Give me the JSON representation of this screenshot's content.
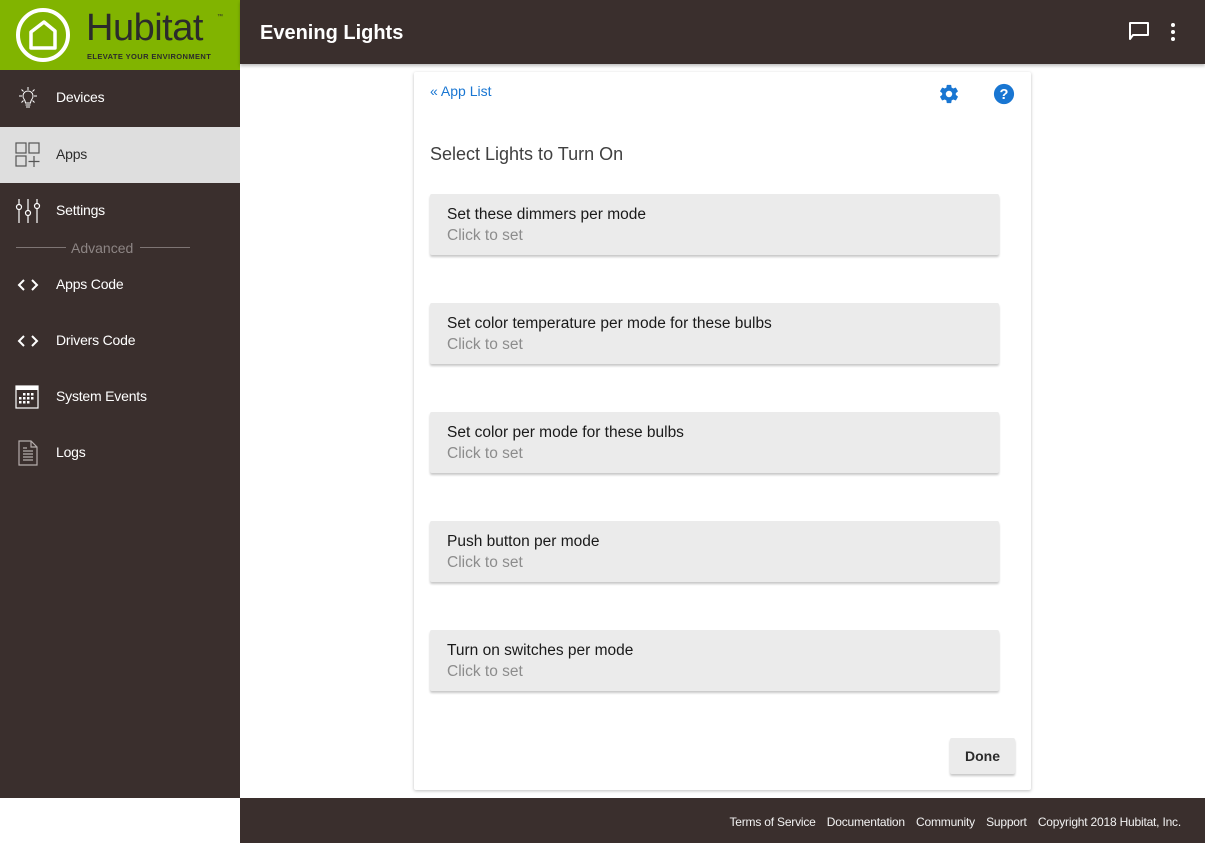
{
  "brand": {
    "name": "Hubitat",
    "trademark": "™",
    "tagline": "ELEVATE YOUR ENVIRONMENT",
    "color": "#81b400"
  },
  "header": {
    "title": "Evening Lights",
    "icons": [
      "chat-icon",
      "more-vert-icon"
    ]
  },
  "sidebar": {
    "items": [
      {
        "label": "Devices",
        "icon": "lightbulb-icon",
        "active": false
      },
      {
        "label": "Apps",
        "icon": "apps-grid-icon",
        "active": true
      },
      {
        "label": "Settings",
        "icon": "sliders-icon",
        "active": false
      },
      {
        "label": "Apps Code",
        "icon": "code-icon",
        "active": false
      },
      {
        "label": "Drivers Code",
        "icon": "code-icon",
        "active": false
      },
      {
        "label": "System Events",
        "icon": "calendar-icon",
        "active": false
      },
      {
        "label": "Logs",
        "icon": "document-icon",
        "active": false
      }
    ],
    "section_divider": "Advanced"
  },
  "main": {
    "back_link": "« App List",
    "section_title": "Select Lights to Turn On",
    "settings": [
      {
        "title": "Set these dimmers per mode",
        "subtitle": "Click to set"
      },
      {
        "title": "Set color temperature per mode for these bulbs",
        "subtitle": "Click to set"
      },
      {
        "title": "Set color per mode for these bulbs",
        "subtitle": "Click to set"
      },
      {
        "title": "Push button per mode",
        "subtitle": "Click to set"
      },
      {
        "title": "Turn on switches per mode",
        "subtitle": "Click to set"
      }
    ],
    "done_label": "Done",
    "accent_color": "#1976d2"
  },
  "footer": {
    "links": [
      "Terms of Service",
      "Documentation",
      "Community",
      "Support"
    ],
    "copyright": "Copyright 2018 Hubitat, Inc."
  }
}
